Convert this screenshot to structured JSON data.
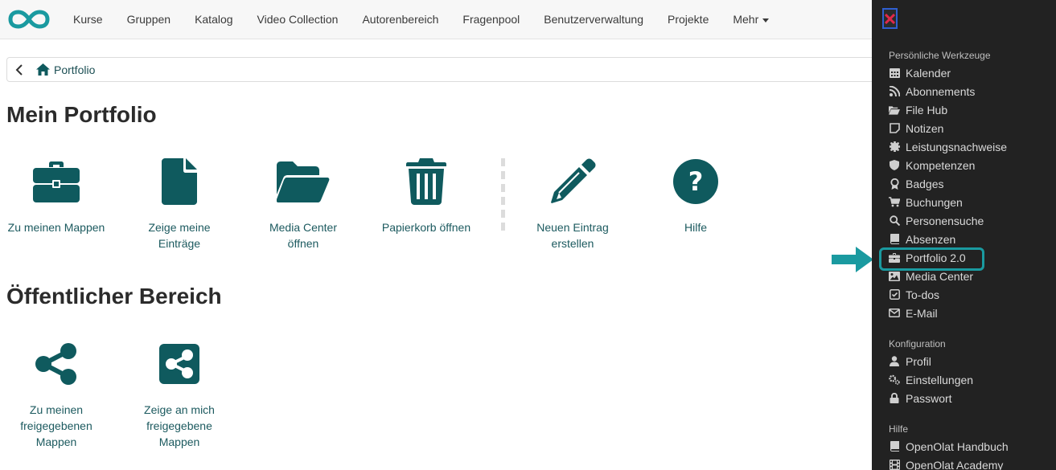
{
  "nav": {
    "items": [
      "Kurse",
      "Gruppen",
      "Katalog",
      "Video Collection",
      "Autorenbereich",
      "Fragenpool",
      "Benutzerverwaltung",
      "Projekte"
    ],
    "more_label": "Mehr"
  },
  "breadcrumb": {
    "label": "Portfolio"
  },
  "sections": {
    "mine": "Mein Portfolio",
    "public": "Öffentlicher Bereich"
  },
  "tools": {
    "binders": "Zu meinen Mappen",
    "entries": "Zeige meine Einträge",
    "media": "Media Center öffnen",
    "trash": "Papierkorb öffnen",
    "new_entry": "Neuen Eintrag erstellen",
    "help": "Hilfe",
    "shared_mine": "Zu meinen freigegebenen Mappen",
    "shared_with_me": "Zeige an mich freigegebene Mappen"
  },
  "panel": {
    "group_personal": "Persönliche Werkzeuge",
    "personal": [
      "Kalender",
      "Abonnements",
      "File Hub",
      "Notizen",
      "Leistungsnachweise",
      "Kompetenzen",
      "Badges",
      "Buchungen",
      "Personensuche",
      "Absenzen",
      "Portfolio 2.0",
      "Media Center",
      "To-dos",
      "E-Mail"
    ],
    "group_config": "Konfiguration",
    "config": [
      "Profil",
      "Einstellungen",
      "Passwort"
    ],
    "group_help": "Hilfe",
    "help": [
      "OpenOlat Handbuch",
      "OpenOlat Academy"
    ]
  },
  "colors": {
    "brand": "#1a9aa0",
    "icon": "#0f5a5e",
    "panel_bg": "#222222",
    "highlight": "#1a9aa0"
  }
}
